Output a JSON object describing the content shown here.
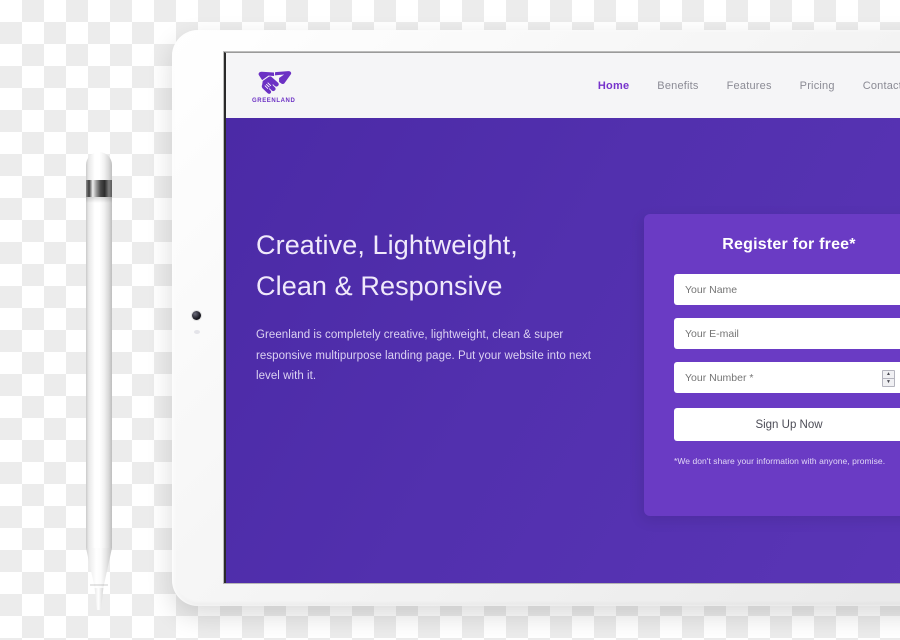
{
  "device": {
    "type": "tablet",
    "camera_icon": "camera-dot-icon",
    "stylus_icon": "stylus"
  },
  "site": {
    "brand": {
      "logo_icon": "handshake-icon",
      "name": "GREENLAND"
    },
    "nav": {
      "items": [
        {
          "label": "Home",
          "active": true
        },
        {
          "label": "Benefits",
          "active": false
        },
        {
          "label": "Features",
          "active": false
        },
        {
          "label": "Pricing",
          "active": false
        },
        {
          "label": "Contact",
          "active": false
        }
      ]
    },
    "hero": {
      "title_line1": "Creative, Lightweight,",
      "title_line2": "Clean & Responsive",
      "subtitle": "Greenland is completely creative, lightweight, clean & super responsive multipurpose landing page. Put your website into next level with it."
    },
    "register_form": {
      "title": "Register for free*",
      "fields": [
        {
          "name": "name",
          "placeholder": "Your Name",
          "value": ""
        },
        {
          "name": "email",
          "placeholder": "Your E-mail",
          "value": ""
        },
        {
          "name": "number",
          "placeholder": "Your Number *",
          "value": "",
          "spinner": true
        }
      ],
      "spinner_up": "▲",
      "spinner_down": "▼",
      "submit_label": "Sign Up Now",
      "privacy_note": "*We don't share your information with anyone, promise."
    }
  },
  "colors": {
    "brand_purple": "#7733cc",
    "hero_purple": "#5230ae",
    "panel_purple": "#6a3bc4",
    "header_bg": "#f5f5f7",
    "nav_inactive": "#8b8b95",
    "button_bg": "#ffffff"
  }
}
